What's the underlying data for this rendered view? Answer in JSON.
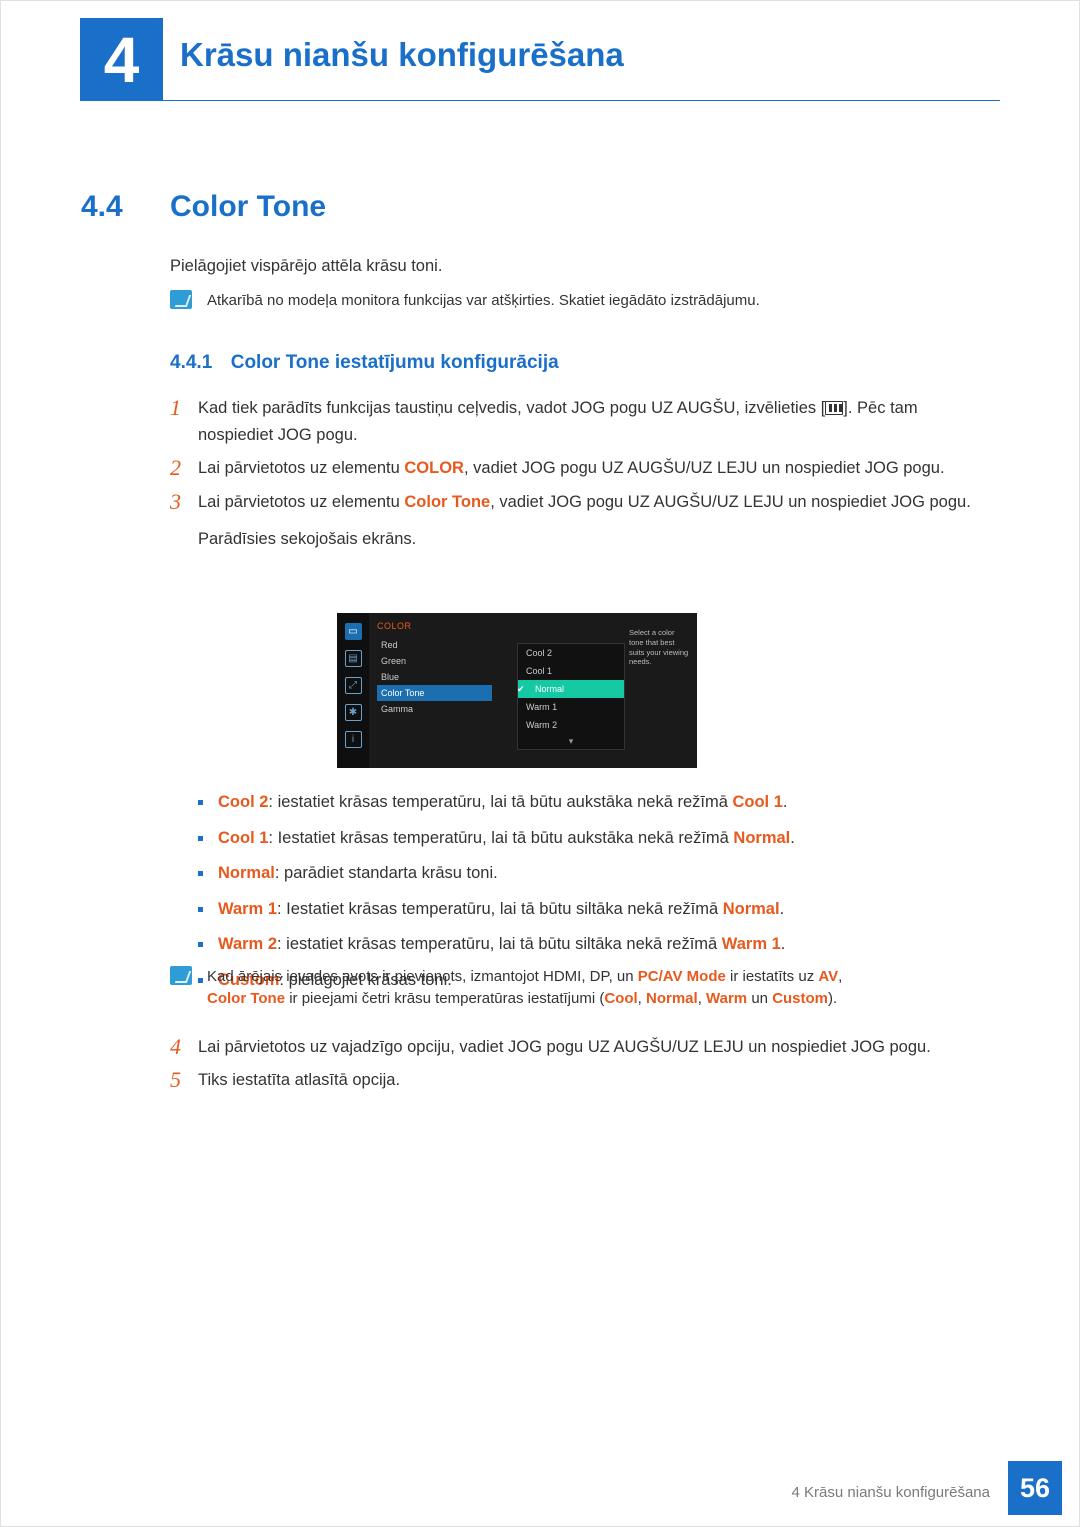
{
  "chapter": {
    "number": "4",
    "title": "Krāsu nianšu konfigurēšana"
  },
  "section": {
    "number": "4.4",
    "title": "Color Tone",
    "intro": "Pielāgojiet vispārējo attēla krāsu toni."
  },
  "note1": "Atkarībā no modeļa monitora funkcijas var atšķirties. Skatiet iegādāto izstrādājumu.",
  "subsection": {
    "number": "4.4.1",
    "title": "Color Tone iestatījumu konfigurācija"
  },
  "steps": {
    "s1a": "Kad tiek parādīts funkcijas taustiņu ceļvedis, vadot JOG pogu UZ AUGŠU, izvēlieties [",
    "s1b": "]. Pēc tam nospiediet JOG pogu.",
    "s2a": "Lai pārvietotos uz elementu ",
    "s2_color": "COLOR",
    "s2b": ", vadiet JOG pogu UZ AUGŠU/UZ LEJU un nospiediet JOG pogu.",
    "s3a": "Lai pārvietotos uz elementu ",
    "s3_ct": "Color Tone",
    "s3b": ", vadiet JOG pogu UZ AUGŠU/UZ LEJU un nospiediet JOG pogu.",
    "s3c": "Parādīsies sekojošais ekrāns.",
    "s4": "Lai pārvietotos uz vajadzīgo opciju, vadiet JOG pogu UZ AUGŠU/UZ LEJU un nospiediet JOG pogu.",
    "s5": "Tiks iestatīta atlasītā opcija."
  },
  "osd": {
    "menu_title": "COLOR",
    "items": [
      "Red",
      "Green",
      "Blue",
      "Color Tone",
      "Gamma"
    ],
    "highlight_index": 3,
    "sub_items": [
      "Cool 2",
      "Cool 1",
      "Normal",
      "Warm 1",
      "Warm 2"
    ],
    "sub_selected_index": 2,
    "help": "Select a color tone that best suits your viewing needs."
  },
  "bullets": {
    "b1a": "Cool 2",
    "b1b": ": iestatiet krāsas temperatūru, lai tā būtu aukstāka nekā režīmā ",
    "b1c": "Cool 1",
    "b1d": ".",
    "b2a": "Cool 1",
    "b2b": ": Iestatiet krāsas temperatūru, lai tā būtu aukstāka nekā režīmā ",
    "b2c": "Normal",
    "b2d": ".",
    "b3a": "Normal",
    "b3b": ": parādiet standarta krāsu toni.",
    "b4a": "Warm 1",
    "b4b": ": Iestatiet krāsas temperatūru, lai tā būtu siltāka nekā režīmā ",
    "b4c": "Normal",
    "b4d": ".",
    "b5a": "Warm 2",
    "b5b": ": iestatiet krāsas temperatūru, lai tā būtu siltāka nekā režīmā ",
    "b5c": "Warm 1",
    "b5d": ".",
    "b6a": "Custom",
    "b6b": ": pielāgojiet krāsas toni."
  },
  "note2": {
    "l1a": "Kad ārējais ievades avots ir pievienots, izmantojot HDMI, DP, un ",
    "l1_pc": "PC/AV Mode",
    "l1b": " ir iestatīts uz ",
    "l1_av": "AV",
    "l1c": ",",
    "l2_ct": "Color Tone",
    "l2a": " ir pieejami četri krāsu temperatūras iestatījumi (",
    "l2_cool": "Cool",
    "comma1": ", ",
    "l2_normal": "Normal",
    "comma2": ", ",
    "l2_warm": "Warm",
    "un": " un ",
    "l2_custom": "Custom",
    "l2b": ")."
  },
  "footer": {
    "text": "4 Krāsu nianšu konfigurēšana",
    "page": "56"
  },
  "nums": {
    "n1": "1",
    "n2": "2",
    "n3": "3",
    "n4": "4",
    "n5": "5"
  }
}
